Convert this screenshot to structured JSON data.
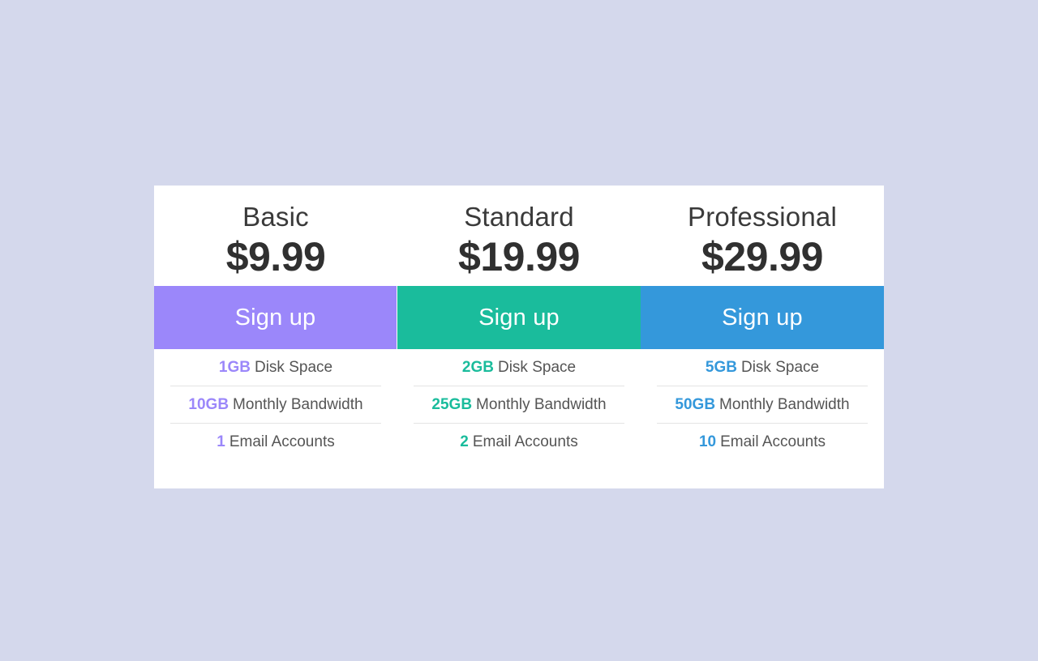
{
  "page": {
    "background_color": "#d4d8ec",
    "card_background": "#ffffff",
    "divider_color": "#e4e4e4"
  },
  "plans": [
    {
      "name": "Basic",
      "price": "$9.99",
      "cta_label": "Sign up",
      "accent_color": "#9b87fa",
      "features": [
        {
          "qty": "1GB",
          "label": "Disk Space"
        },
        {
          "qty": "10GB",
          "label": "Monthly Bandwidth"
        },
        {
          "qty": "1",
          "label": "Email Accounts"
        }
      ]
    },
    {
      "name": "Standard",
      "price": "$19.99",
      "cta_label": "Sign up",
      "accent_color": "#1abc9c",
      "features": [
        {
          "qty": "2GB",
          "label": "Disk Space"
        },
        {
          "qty": "25GB",
          "label": "Monthly Bandwidth"
        },
        {
          "qty": "2",
          "label": "Email Accounts"
        }
      ]
    },
    {
      "name": "Professional",
      "price": "$29.99",
      "cta_label": "Sign up",
      "accent_color": "#3498db",
      "features": [
        {
          "qty": "5GB",
          "label": "Disk Space"
        },
        {
          "qty": "50GB",
          "label": "Monthly Bandwidth"
        },
        {
          "qty": "10",
          "label": "Email Accounts"
        }
      ]
    }
  ]
}
